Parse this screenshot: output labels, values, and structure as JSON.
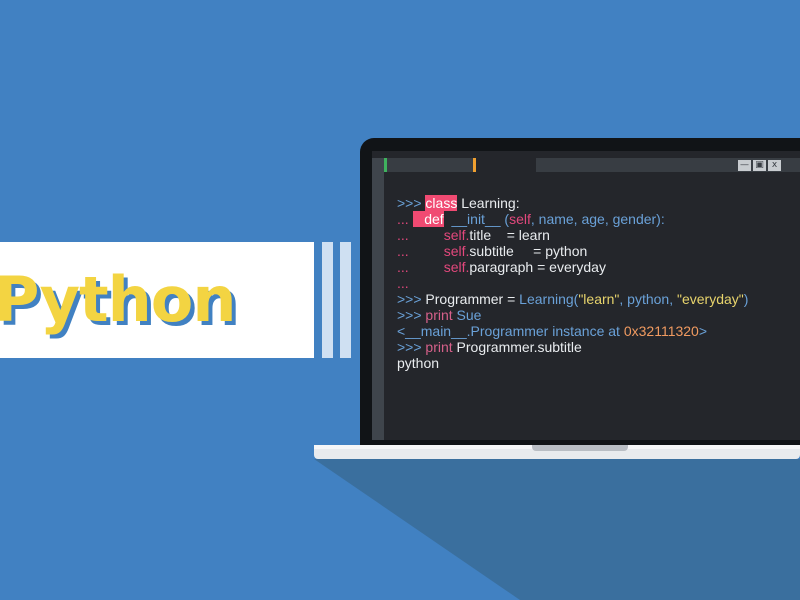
{
  "title": "Python",
  "colors": {
    "background": "#4181c2",
    "banner": "#ffffff",
    "title": "#f3d442",
    "screen": "#24262b",
    "keyword_highlight": "#f04a72"
  },
  "window": {
    "minimize_icon": "minimize-icon",
    "maximize_icon": "maximize-icon",
    "close_label": "x"
  },
  "code_lines": [
    [
      {
        "t": ">>> ",
        "c": "p"
      },
      {
        "t": "class",
        "c": "hl"
      },
      {
        "t": " Learning:",
        "c": ""
      }
    ],
    [
      {
        "t": "... ",
        "c": "cont"
      },
      {
        "t": "   def",
        "c": "hl"
      },
      {
        "t": "  __init__ (",
        "c": "fn"
      },
      {
        "t": "self",
        "c": "cont"
      },
      {
        "t": ", name, age, gender):",
        "c": "fn"
      }
    ],
    [
      {
        "t": "...         ",
        "c": "cont"
      },
      {
        "t": "self.",
        "c": "cont"
      },
      {
        "t": "title    = learn",
        "c": ""
      }
    ],
    [
      {
        "t": "...         ",
        "c": "cont"
      },
      {
        "t": "self.",
        "c": "cont"
      },
      {
        "t": "subtitle     = python",
        "c": ""
      }
    ],
    [
      {
        "t": "...         ",
        "c": "cont"
      },
      {
        "t": "self.",
        "c": "cont"
      },
      {
        "t": "paragraph = everyday",
        "c": ""
      }
    ],
    [
      {
        "t": "...",
        "c": "cont"
      }
    ],
    [
      {
        "t": ">>> ",
        "c": "p"
      },
      {
        "t": "Programmer = ",
        "c": ""
      },
      {
        "t": "Learning(",
        "c": "fn"
      },
      {
        "t": "\"learn\"",
        "c": "str"
      },
      {
        "t": ", python, ",
        "c": "fn"
      },
      {
        "t": "\"everyday\"",
        "c": "str"
      },
      {
        "t": ")",
        "c": "fn"
      }
    ],
    [
      {
        "t": ">>> ",
        "c": "p"
      },
      {
        "t": "print",
        "c": "kw"
      },
      {
        "t": " Sue",
        "c": "fn"
      }
    ],
    [
      {
        "t": "<__main__.Programmer instance at ",
        "c": "fn"
      },
      {
        "t": "0x32111320",
        "c": "num"
      },
      {
        "t": ">",
        "c": "fn"
      }
    ],
    [
      {
        "t": ">>> ",
        "c": "p"
      },
      {
        "t": "print",
        "c": "kw"
      },
      {
        "t": " Programmer.subtitle",
        "c": ""
      }
    ],
    [
      {
        "t": "python",
        "c": ""
      }
    ]
  ]
}
